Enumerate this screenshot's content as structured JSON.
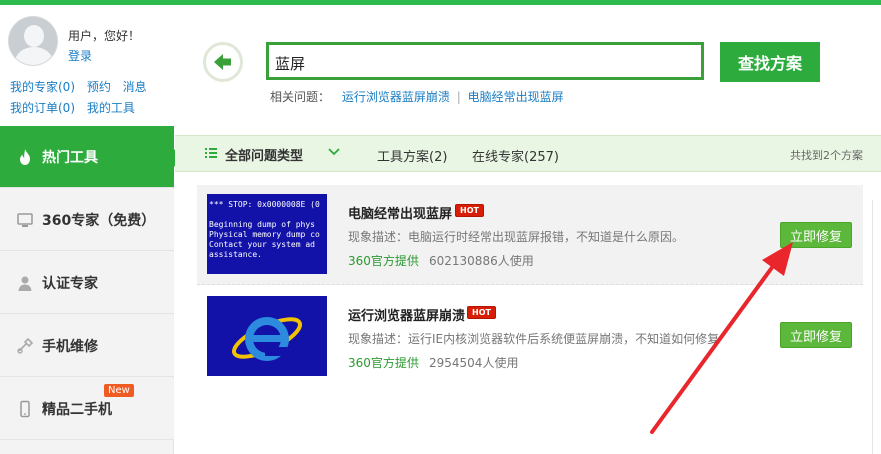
{
  "user": {
    "greeting": "用户，您好！",
    "login": "登录",
    "links_row1": [
      "我的专家(0)",
      "预约",
      "消息"
    ],
    "links_row2": [
      "我的订单(0)",
      "我的工具"
    ]
  },
  "sidebar": {
    "items": [
      {
        "label": "热门工具",
        "icon": "flame-icon",
        "active": true
      },
      {
        "label": "360专家（免费）",
        "icon": "monitor-icon",
        "active": false
      },
      {
        "label": "认证专家",
        "icon": "person-icon",
        "active": false
      },
      {
        "label": "手机维修",
        "icon": "phone-repair-icon",
        "active": false
      },
      {
        "label": "精品二手机",
        "icon": "mobile-phone-icon",
        "active": false,
        "badge": "New"
      }
    ]
  },
  "search": {
    "value": "蓝屏",
    "button": "查找方案",
    "related_label": "相关问题：",
    "related": [
      "运行浏览器蓝屏崩溃",
      "电脑经常出现蓝屏"
    ],
    "separator": "|"
  },
  "filter": {
    "all_types": "全部问题类型",
    "tools": "工具方案(2)",
    "experts": "在线专家(257)",
    "found": "共找到2个方案"
  },
  "results": [
    {
      "title": "电脑经常出现蓝屏",
      "hot": "HOT",
      "desc": "现象描述：电脑运行时经常出现蓝屏报错，不知道是什么原因。",
      "source": "360官方提供",
      "users": "602130886人使用",
      "button": "立即修复",
      "thumb_text": "*** STOP: 0x0000008E (0\n\nBeginning dump of phys\nPhysical memory dump co\nContact your system ad\nassistance."
    },
    {
      "title": "运行浏览器蓝屏崩溃",
      "hot": "HOT",
      "desc": "现象描述：运行IE内核浏览器软件后系统便蓝屏崩溃，不知道如何修复",
      "source": "360官方提供",
      "users": "2954504人使用",
      "button": "立即修复"
    }
  ],
  "colors": {
    "brand_green": "#2dac3d",
    "link_blue": "#1a7dc4",
    "hot_red": "#d81e06",
    "annotation_arrow": "#e8262b"
  }
}
